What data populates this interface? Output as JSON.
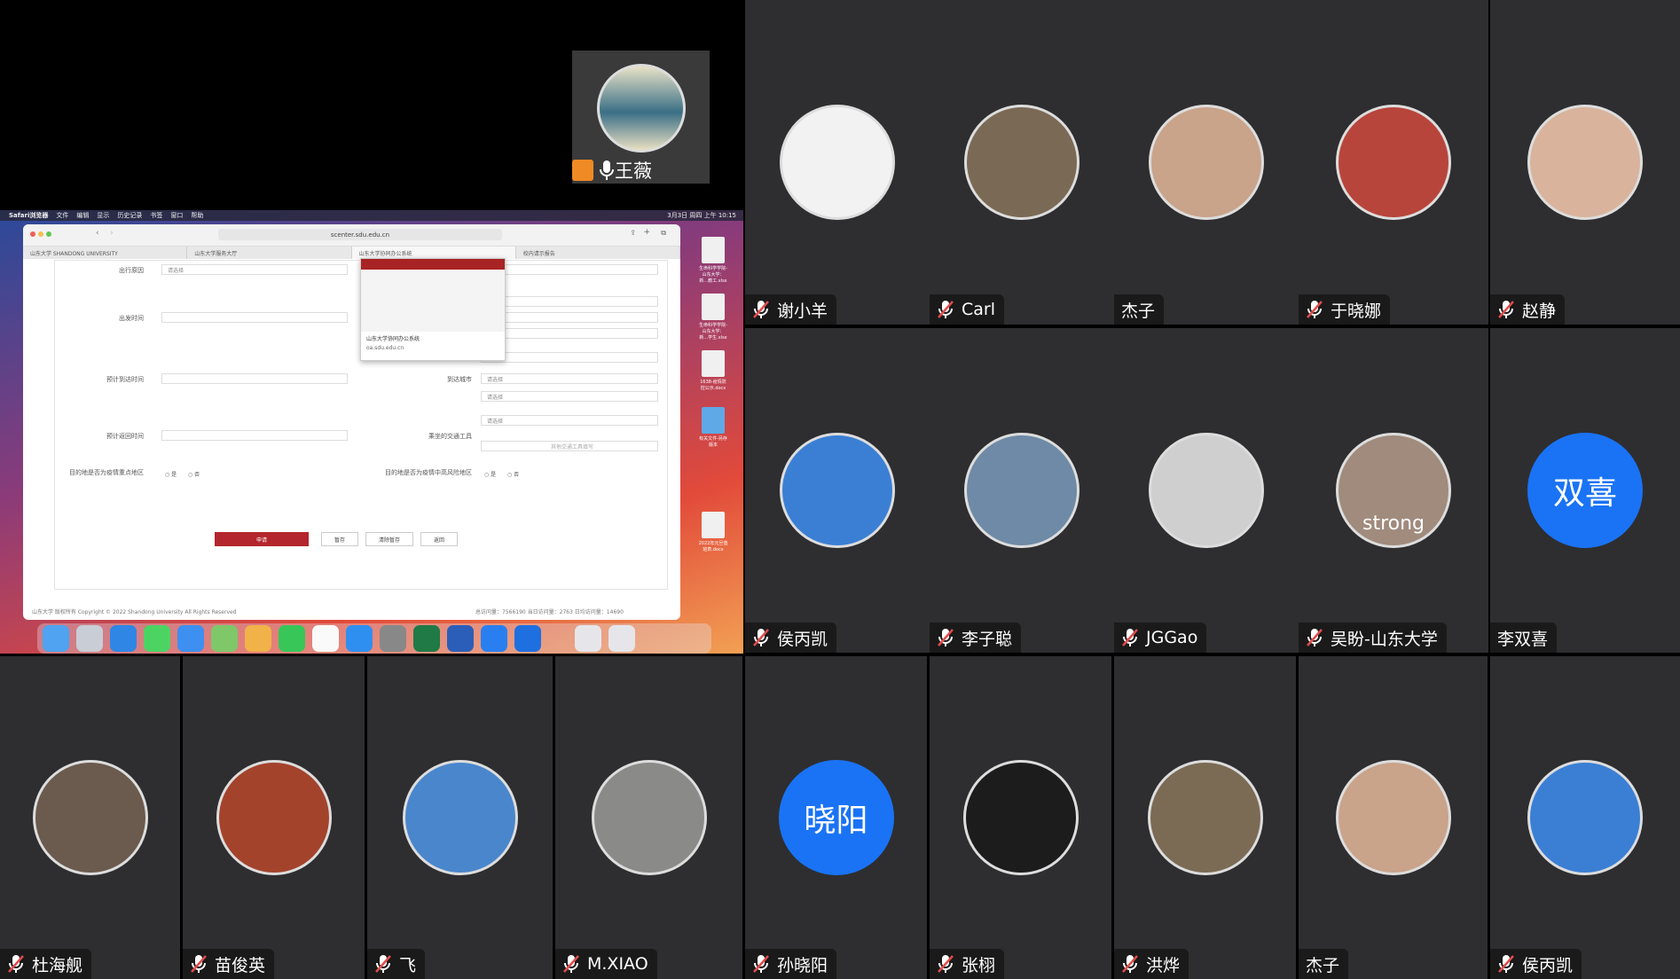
{
  "self_view": {
    "name": "王薇"
  },
  "shared_screen": {
    "menubar": [
      "Safari浏览器",
      "文件",
      "编辑",
      "显示",
      "历史记录",
      "书签",
      "窗口",
      "帮助"
    ],
    "clock": "3月3日 周四 上午 10:15",
    "url": "scenter.sdu.edu.cn",
    "tabs": [
      "山东大学 SHANDONG UNIVERSITY",
      "山东大学服务大厅",
      "山东大学协同办公系统",
      "校内请示报告"
    ],
    "tooltip": {
      "title": "山东大学协同办公系统",
      "url": "oa.sdu.edu.cn"
    },
    "form": {
      "reason_label": "出行原因",
      "reason_value": "请选择",
      "depart_label": "出发时间",
      "arrive_label": "预计到达时间",
      "arrive_city_label": "到达城市",
      "arrive_city_value": "请选择",
      "arrive_city_value2": "请选择",
      "return_label": "预计返回时间",
      "transport_label": "乘坐的交通工具",
      "transport_value": "请选择",
      "other_transport": "其他交通工具填写",
      "risk_area_label": "目的地是否为疫情重点地区",
      "high_risk_label": "目的地是否为疫情中高风险地区",
      "yes": "是",
      "no": "否",
      "submit": "申请",
      "save": "暂存",
      "clear": "清除暂存",
      "back": "返回"
    },
    "footer": "山东大学 版权所有 Copyright © 2022 Shandong University All Rights Reserved",
    "stats": "总访问量：7566190    当日访问量：2763    日均访问量：14690",
    "desktop_files": [
      "生命科学学院-山东大学：新...教工.xlsx",
      "生命科学学院-山东大学：新...学生.xlsx",
      "1638-疫情防控公示.docx",
      "有关文件-另存版本",
      "2022年元旦值班表.docx"
    ]
  },
  "participants": [
    {
      "name": "谢小羊",
      "avatar": "avatar-cartoon",
      "avatar_color": "#f2f2f2",
      "muted": true
    },
    {
      "name": "Carl",
      "avatar": "avatar-photo-man",
      "avatar_color": "#7a6a55",
      "muted": true
    },
    {
      "name": "杰子",
      "avatar": "avatar-books",
      "avatar_color": "#c9a38a",
      "muted": false
    },
    {
      "name": "于晓娜",
      "avatar": "avatar-piano",
      "avatar_color": "#b8453c",
      "muted": true
    },
    {
      "name": "赵静",
      "avatar": "avatar-girl",
      "avatar_color": "#d9b39c",
      "muted": true
    },
    {
      "name": "侯丙凯",
      "avatar": "avatar-sky-city",
      "avatar_color": "#3b7fd4",
      "muted": true
    },
    {
      "name": "李子聪",
      "avatar": "avatar-city-river",
      "avatar_color": "#6e8aa6",
      "muted": true
    },
    {
      "name": "JGGao",
      "avatar": "avatar-default",
      "avatar_color": "#cfcfcf",
      "muted": true
    },
    {
      "name": "吴盼-山东大学",
      "avatar": "avatar-cat",
      "avatar_color": "#a08b7d",
      "overlay": "strong",
      "muted": true
    },
    {
      "name": "李双喜",
      "avatar_text": "双喜",
      "muted": false
    },
    {
      "name": "杜海舰",
      "avatar": "avatar-photo-man2",
      "avatar_color": "#6b5a4e",
      "muted": true
    },
    {
      "name": "苗俊英",
      "avatar": "avatar-berries",
      "avatar_color": "#a4432c",
      "muted": true
    },
    {
      "name": "飞",
      "avatar": "avatar-clouds",
      "avatar_color": "#4a86cc",
      "muted": true
    },
    {
      "name": "M.XIAO",
      "avatar": "avatar-rock",
      "avatar_color": "#8a8a88",
      "muted": true
    },
    {
      "name": "孙晓阳",
      "avatar_text": "晓阳",
      "muted": true
    },
    {
      "name": "张栩",
      "avatar": "avatar-pooh",
      "avatar_color": "#1c1c1c",
      "muted": true
    },
    {
      "name": "洪烨",
      "avatar": "avatar-plant",
      "avatar_color": "#7b6b55",
      "muted": true
    },
    {
      "name": "杰子",
      "avatar": "avatar-books",
      "avatar_color": "#c9a38a",
      "muted": false
    },
    {
      "name": "侯丙凯",
      "avatar": "avatar-sky-city",
      "avatar_color": "#3b7fd4",
      "muted": true
    }
  ],
  "colors": {
    "tile_bg": "#2e2e30",
    "mic_muted": "#e34b4b",
    "text_avatar": "#1a73f5",
    "submit_red": "#b3262d"
  }
}
